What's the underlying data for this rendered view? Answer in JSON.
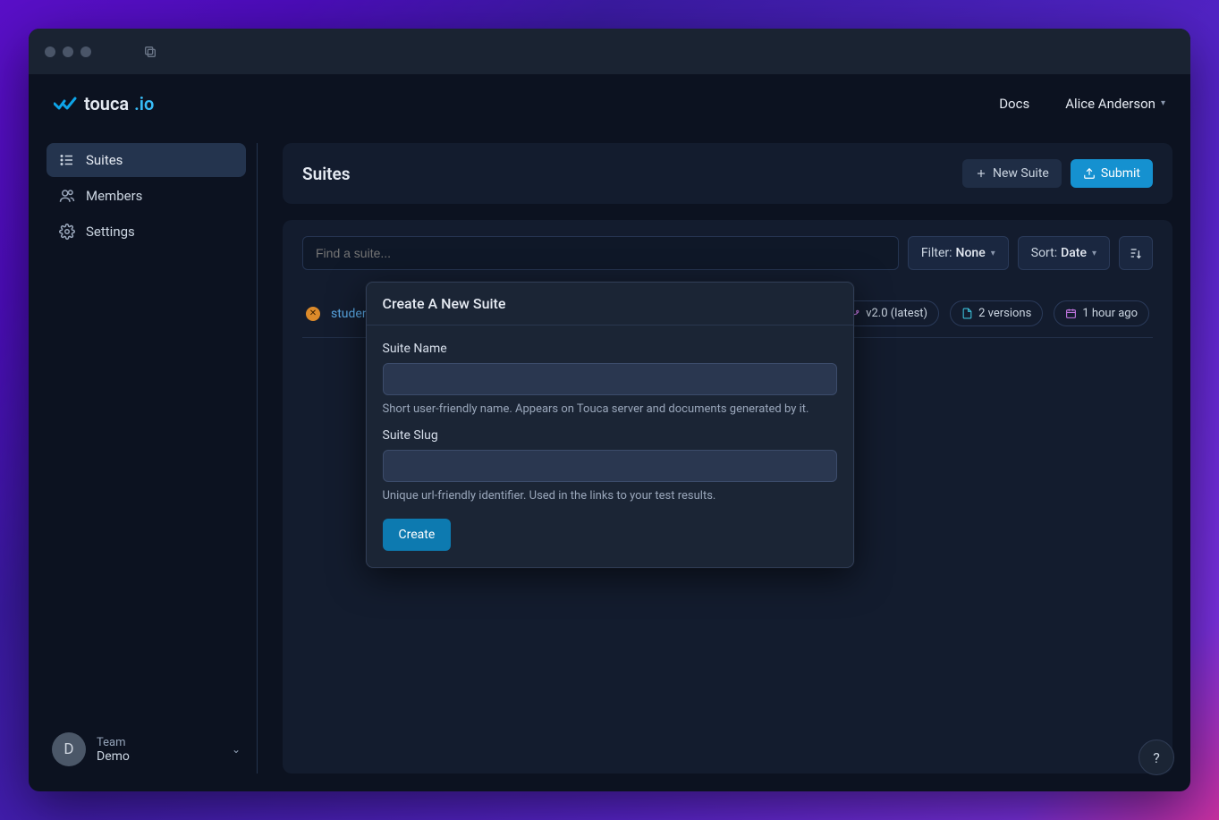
{
  "logo": {
    "word1": "touca",
    "word2": ".io"
  },
  "nav": {
    "docs": "Docs",
    "user_name": "Alice Anderson"
  },
  "sidebar": {
    "items": [
      {
        "label": "Suites"
      },
      {
        "label": "Members"
      },
      {
        "label": "Settings"
      }
    ],
    "team": {
      "initial": "D",
      "label": "Team",
      "value": "Demo"
    }
  },
  "header": {
    "title": "Suites",
    "new_suite": "New Suite",
    "submit": "Submit"
  },
  "toolbar": {
    "search_placeholder": "Find a suite...",
    "filter_label": "Filter:",
    "filter_value": "None",
    "sort_label": "Sort:",
    "sort_value": "Date"
  },
  "rows": [
    {
      "name": "students",
      "version": "v2.0 (latest)",
      "versions_count": "2 versions",
      "time_ago": "1 hour ago"
    }
  ],
  "modal": {
    "title": "Create A New Suite",
    "name_label": "Suite Name",
    "name_hint": "Short user-friendly name. Appears on Touca server and documents generated by it.",
    "slug_label": "Suite Slug",
    "slug_hint": "Unique url-friendly identifier. Used in the links to your test results.",
    "create": "Create"
  },
  "help": "?"
}
